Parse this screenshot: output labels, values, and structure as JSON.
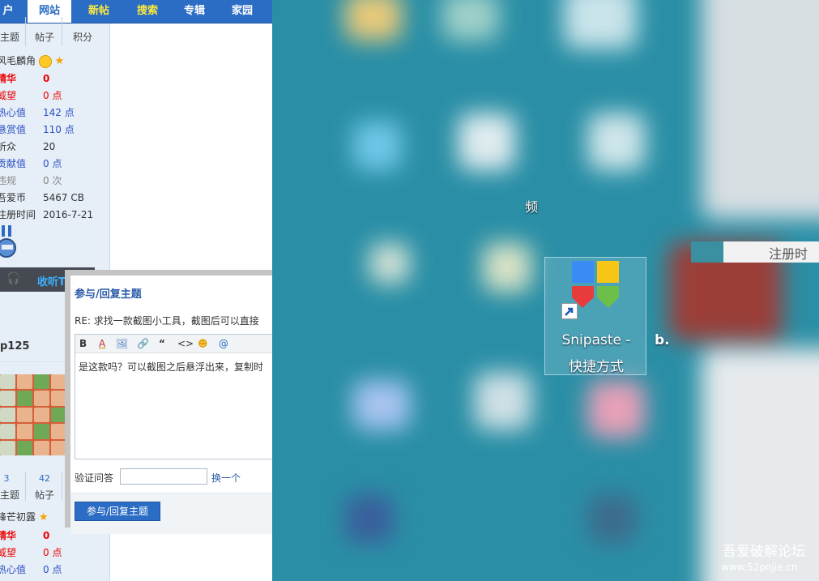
{
  "nav": {
    "items": [
      {
        "label": "户",
        "style": "normal"
      },
      {
        "label": "网站",
        "style": "active"
      },
      {
        "label": "新帖",
        "style": "yellow"
      },
      {
        "label": "搜索",
        "style": "yellow"
      },
      {
        "label": "专辑",
        "style": "normal"
      },
      {
        "label": "家园",
        "style": "normal"
      }
    ]
  },
  "user1": {
    "stat_labels": [
      "主题",
      "帖子",
      "积分"
    ],
    "title": "风毛麟角",
    "rows": [
      {
        "key": "精华",
        "value": "0",
        "style": "red-bold"
      },
      {
        "key": "威望",
        "value": "0 点",
        "style": "red"
      },
      {
        "key": "热心值",
        "value": "142 点",
        "style": "blue"
      },
      {
        "key": "悬赏值",
        "value": "110 点",
        "style": "blue"
      },
      {
        "key": "听众",
        "value": "20",
        "style": "plain"
      },
      {
        "key": "贡献值",
        "value": "0 点",
        "style": "blue"
      },
      {
        "key": "违规",
        "value": "0 次",
        "style": "gray"
      },
      {
        "key": "吾爱币",
        "value": "5467 CB",
        "style": "plain"
      },
      {
        "key": "注册时间",
        "value": "2016-7-21",
        "style": "plain"
      }
    ]
  },
  "listen_bar": {
    "label": "收听T"
  },
  "user2": {
    "name": "p125",
    "stats": [
      "3",
      "42"
    ],
    "stat_labels": [
      "主题",
      "帖子"
    ],
    "title": "锋芒初露",
    "rows": [
      {
        "key": "精华",
        "value": "0",
        "style": "red-bold"
      },
      {
        "key": "威望",
        "value": "0 点",
        "style": "red"
      },
      {
        "key": "热心值",
        "value": "0 点",
        "style": "blue"
      }
    ]
  },
  "reply_dialog": {
    "title": "参与/回复主题",
    "subject": "RE: 求找一款截图小工具，截图后可以直接",
    "toolbar": [
      "B",
      "A",
      "🖼",
      "🔗",
      "“",
      "<>",
      "☻",
      "@"
    ],
    "body_text": "是这款吗？可以截图之后悬浮出来，复制时",
    "captcha_label": "验证问答",
    "captcha_value": "",
    "captcha_switch": "换一个",
    "submit_label": "参与/回复主题"
  },
  "desktop": {
    "icon_name_line1": "Snipaste -",
    "icon_name_line2": "快捷方式",
    "fragment_b": "b.",
    "fragment_pin": "频",
    "fragment_register": "注册时",
    "colors": {
      "blue": "#3a8cf5",
      "yellow": "#f7c515",
      "red": "#e83c3c",
      "green": "#6cc04a"
    }
  },
  "watermark": {
    "title": "吾爱破解论坛",
    "url": "www.52pojie.cn"
  }
}
